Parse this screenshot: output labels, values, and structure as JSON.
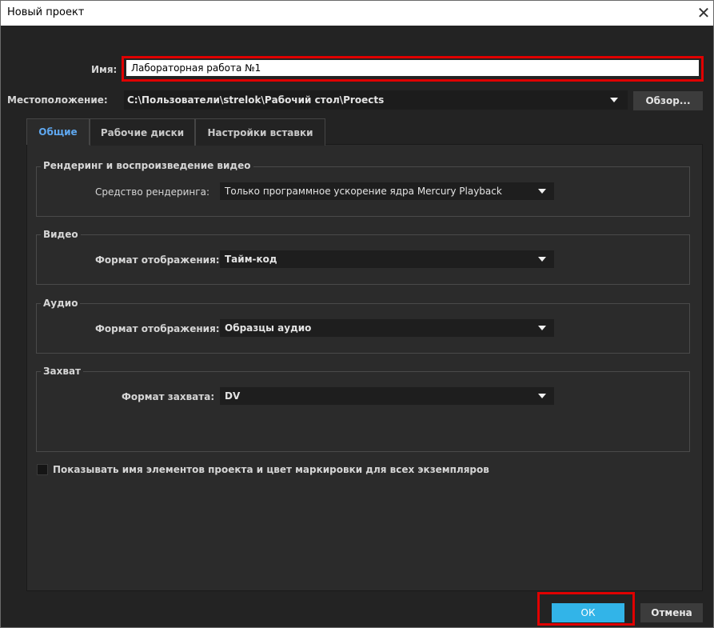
{
  "window": {
    "title": "Новый проект",
    "close_glyph": "✕"
  },
  "name": {
    "label": "Имя:",
    "value": "Лабораторная работа №1"
  },
  "location": {
    "label": "Местоположение:",
    "value": "C:\\Пользователи\\strelok\\Рабочий стол\\Proects",
    "browse_label": "Обзор..."
  },
  "tabs": [
    {
      "label": "Общие",
      "active": true
    },
    {
      "label": "Рабочие диски",
      "active": false
    },
    {
      "label": "Настройки вставки",
      "active": false
    }
  ],
  "groups": {
    "rendering": {
      "title": "Рендеринг и воспроизведение видео",
      "field_label": "Средство рендеринга:",
      "field_value": "Только программное ускорение ядра Mercury Playback"
    },
    "video": {
      "title": "Видео",
      "field_label": "Формат отображения:",
      "field_value": "Тайм-код"
    },
    "audio": {
      "title": "Аудио",
      "field_label": "Формат отображения:",
      "field_value": "Образцы аудио"
    },
    "capture": {
      "title": "Захват",
      "field_label": "Формат захвата:",
      "field_value": "DV"
    }
  },
  "show_names_checkbox": {
    "label": "Показывать имя элементов проекта и цвет маркировки для всех экземпляров",
    "checked": false
  },
  "buttons": {
    "ok": "ОК",
    "cancel": "Отмена"
  },
  "colors": {
    "accent": "#32b4e8",
    "highlight_red": "#e00000",
    "panel_bg": "#2b2b2b",
    "tab_active_text": "#5fa8f0"
  },
  "icons": {
    "close": "close-icon",
    "dropdown": "chevron-down-icon"
  }
}
